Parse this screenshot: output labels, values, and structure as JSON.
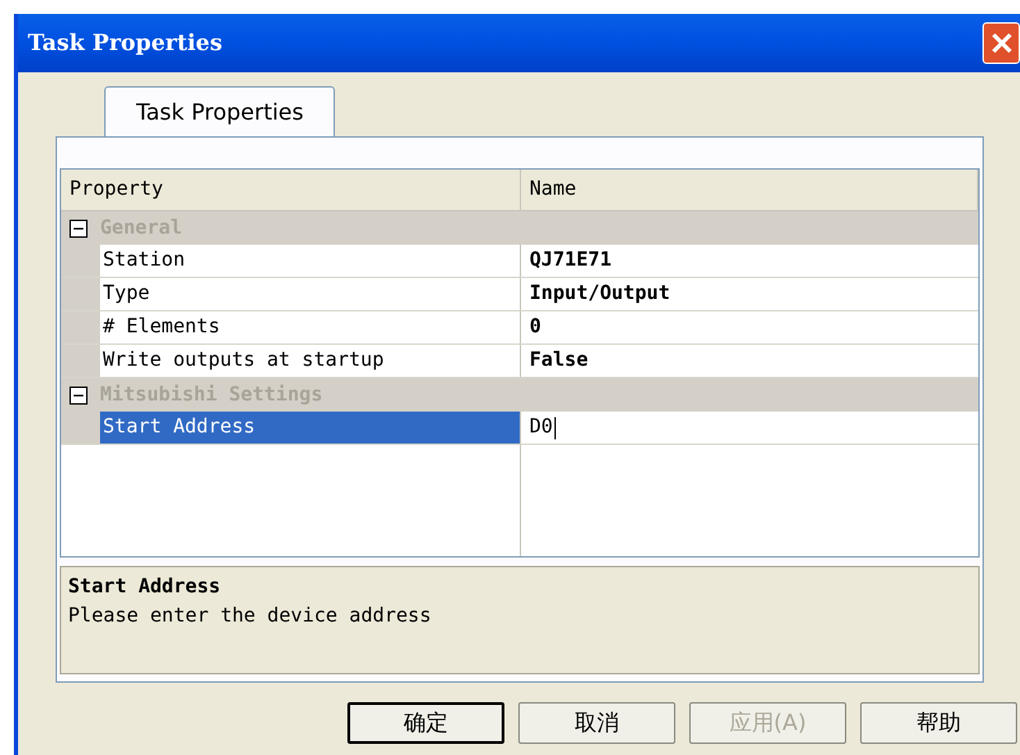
{
  "window": {
    "title": "Task Properties"
  },
  "tabs": [
    {
      "label": "Task Properties",
      "selected": true
    }
  ],
  "grid": {
    "columns": [
      "Property",
      "Name"
    ],
    "categories": [
      {
        "name": "General",
        "expanded": true,
        "properties": [
          {
            "name": "Station",
            "value": "QJ71E71",
            "selected": false
          },
          {
            "name": "Type",
            "value": "Input/Output",
            "selected": false
          },
          {
            "name": "# Elements",
            "value": "0",
            "selected": false
          },
          {
            "name": "Write outputs at startup",
            "value": "False",
            "selected": false
          }
        ]
      },
      {
        "name": "Mitsubishi Settings",
        "expanded": true,
        "properties": [
          {
            "name": "Start Address",
            "value": "D0",
            "selected": true,
            "editing": true
          }
        ]
      }
    ]
  },
  "description": {
    "title": "Start Address",
    "text": "Please enter the device address"
  },
  "buttons": [
    {
      "label": "确定",
      "default": true,
      "disabled": false
    },
    {
      "label": "取消",
      "default": false,
      "disabled": false
    },
    {
      "label": "应用(A)",
      "default": false,
      "disabled": true
    },
    {
      "label": "帮助",
      "default": false,
      "disabled": false
    }
  ]
}
